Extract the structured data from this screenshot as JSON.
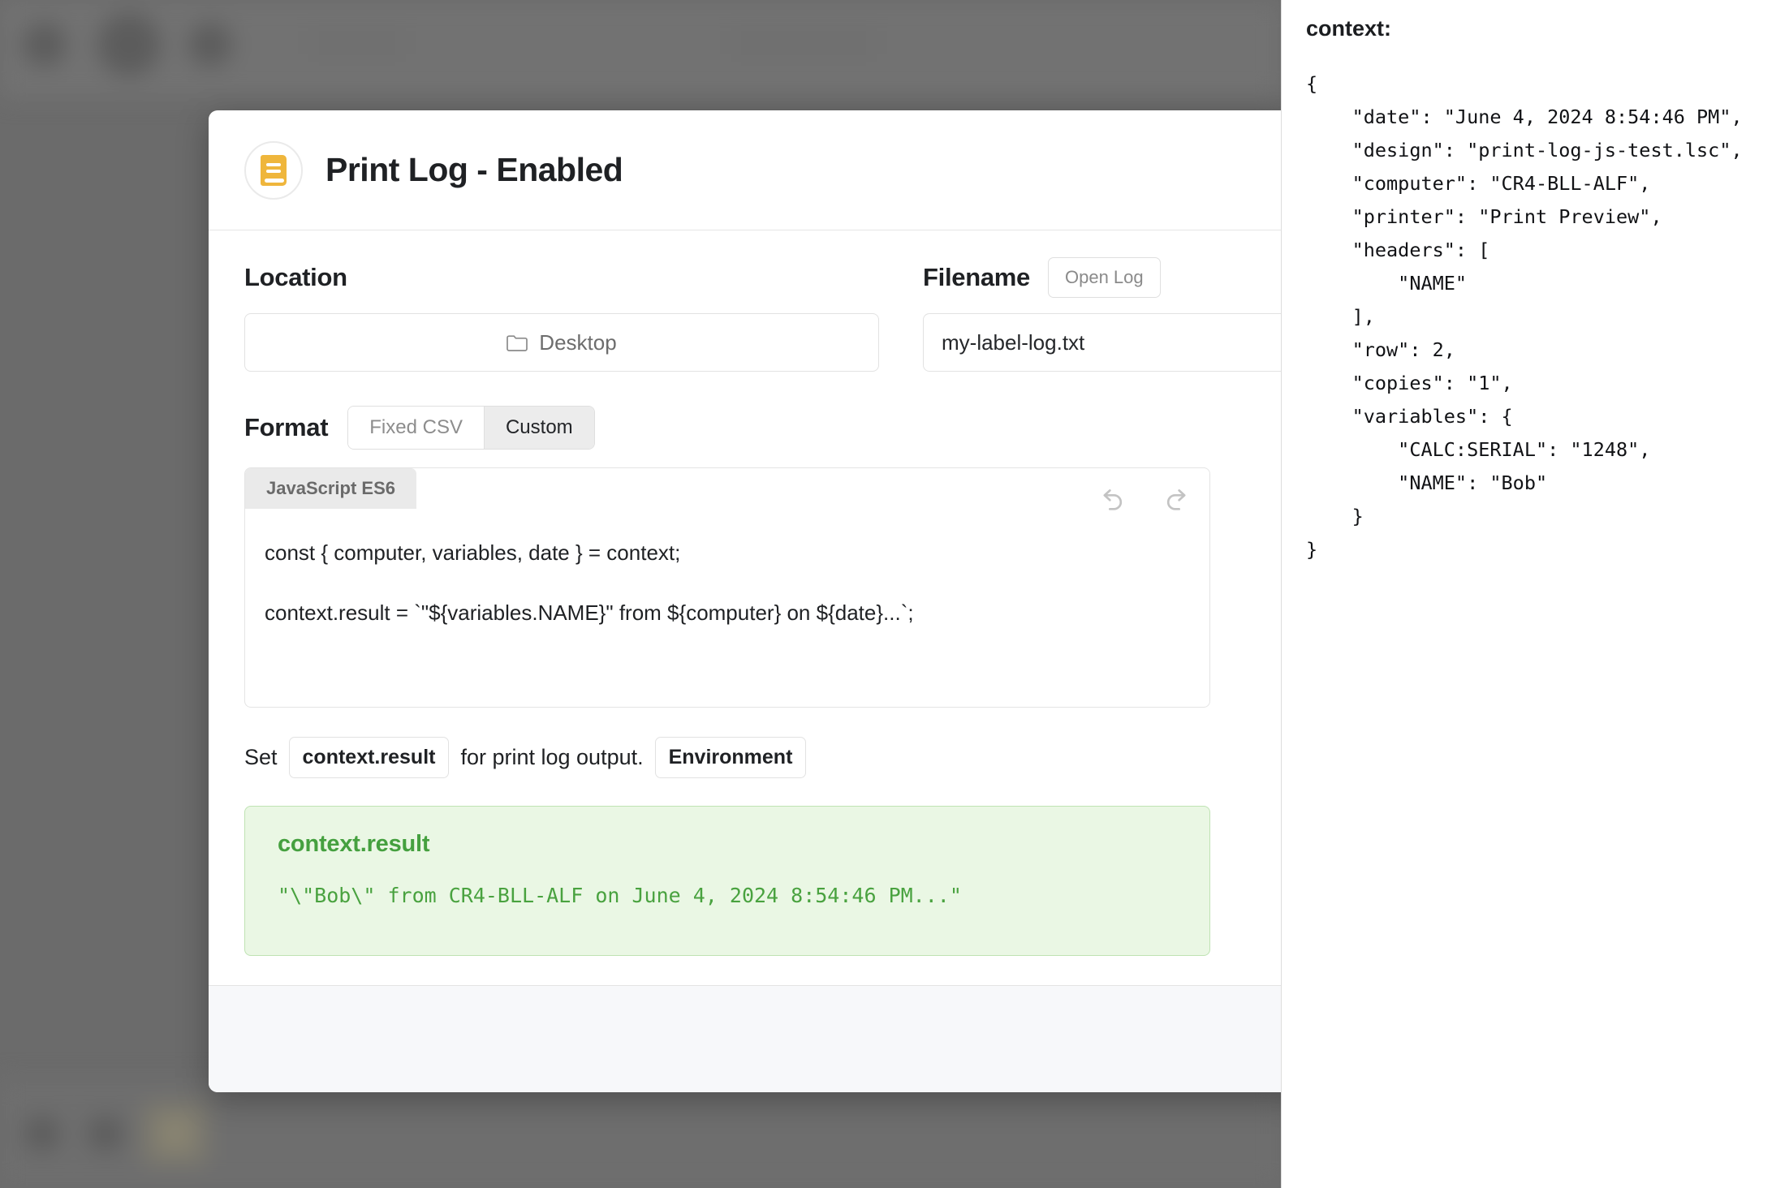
{
  "dialog": {
    "title": "Print Log - Enabled",
    "icon": "book-icon",
    "location": {
      "label": "Location",
      "value": "Desktop",
      "icon": "folder-icon"
    },
    "filename": {
      "label": "Filename",
      "open_log_label": "Open Log",
      "value": "my-label-log.txt",
      "placeholder": "my-label-log.txt"
    },
    "format": {
      "label": "Format",
      "options": [
        {
          "label": "Fixed CSV",
          "selected": false
        },
        {
          "label": "Custom",
          "selected": true
        }
      ]
    },
    "editor": {
      "language_tab": "JavaScript ES6",
      "undo_icon": "undo-icon",
      "redo_icon": "redo-icon",
      "lines": [
        "const { computer, variables, date } = context;",
        "context.result = `\"${variables.NAME}\" from ${computer} on ${date}...`;"
      ]
    },
    "hint": {
      "prefix": "Set",
      "chip_result": "context.result",
      "middle": "for print log output.",
      "chip_environment": "Environment"
    },
    "result": {
      "title": "context.result",
      "value": "\"\\\"Bob\\\" from CR4-BLL-ALF on June 4, 2024 8:54:46 PM...\"",
      "accent_color": "#45a03f",
      "background_color": "#eaf7e4",
      "border_color": "#bfe3b3"
    }
  },
  "sidebar": {
    "title": "context:",
    "json": "{\n    \"date\": \"June 4, 2024 8:54:46 PM\",\n    \"design\": \"print-log-js-test.lsc\",\n    \"computer\": \"CR4-BLL-ALF\",\n    \"printer\": \"Print Preview\",\n    \"headers\": [\n        \"NAME\"\n    ],\n    \"row\": 2,\n    \"copies\": \"1\",\n    \"variables\": {\n        \"CALC:SERIAL\": \"1248\",\n        \"NAME\": \"Bob\"\n    }\n}"
  },
  "theme": {
    "accent": "#efb63c",
    "backdrop": "#6b6b6b",
    "green": "#45a03f"
  }
}
